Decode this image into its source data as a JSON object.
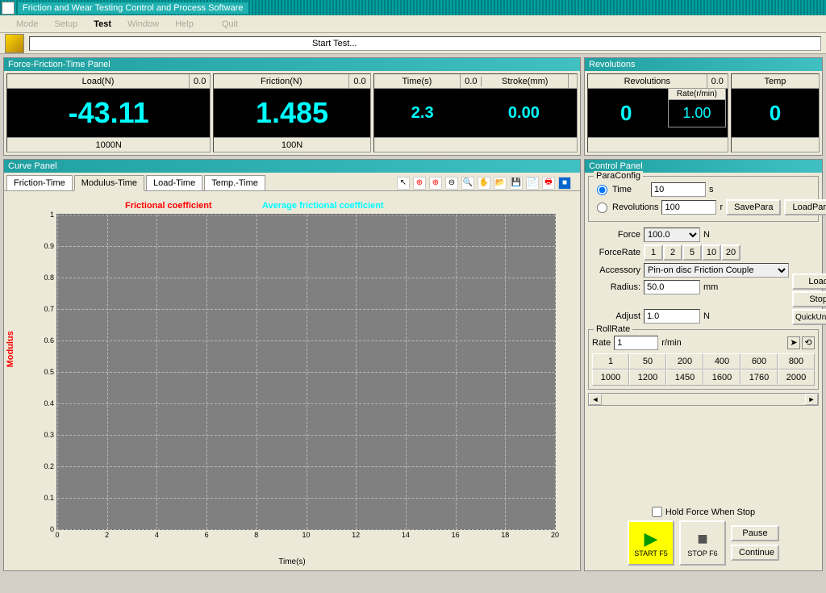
{
  "window": {
    "title": "Friction and Wear Testing Control and Process Software"
  },
  "menu": {
    "items": [
      "Mode",
      "Setup",
      "Test",
      "Window",
      "Help",
      "Quit"
    ],
    "active_index": 2
  },
  "start_bar": "Start Test...",
  "panels": {
    "force_friction": {
      "title": "Force-Friction-Time Panel",
      "load": {
        "label": "Load(N)",
        "small": "0.0",
        "value": "-43.11",
        "range": "1000N"
      },
      "friction": {
        "label": "Friction(N)",
        "small": "0.0",
        "value": "1.485",
        "range": "100N"
      },
      "time": {
        "label": "Time(s)",
        "small": "0.0",
        "value": "2.3"
      },
      "stroke": {
        "label": "Stroke(mm)",
        "small": "",
        "value": "0.00"
      }
    },
    "revolutions": {
      "title": "Revolutions",
      "rev": {
        "label": "Revolutions",
        "small": "0.0",
        "value": "0",
        "rate_label": "Rate(r/min)",
        "rate_value": "1.00"
      },
      "temp": {
        "label": "Temp",
        "value": "0"
      }
    }
  },
  "curve": {
    "title": "Curve Panel",
    "tabs": [
      "Friction-Time",
      "Modulus-Time",
      "Load-Time",
      "Temp.-Time"
    ],
    "active_tab": 1,
    "legend1": "Frictional coefficient",
    "legend2": "Average frictional coefficient",
    "ylabel": "Modulus",
    "xlabel": "Time(s)"
  },
  "control": {
    "title": "Control Panel",
    "para": {
      "legend": "ParaConfig",
      "time_label": "Time",
      "time_val": "10",
      "time_unit": "s",
      "rev_label": "Revolutions",
      "rev_val": "100",
      "rev_unit": "r",
      "save": "SavePara",
      "load": "LoadPara"
    },
    "force": {
      "label": "Force",
      "val": "100.0",
      "unit": "N"
    },
    "force_rate": {
      "label": "ForceRate",
      "buttons": [
        "1",
        "2",
        "5",
        "10",
        "20"
      ]
    },
    "accessory": {
      "label": "Accessory",
      "val": "Pin-on disc  Friction Couple"
    },
    "radius": {
      "label": "Radius:",
      "val": "50.0",
      "unit": "mm"
    },
    "adjust": {
      "label": "Adjust",
      "val": "1.0",
      "unit": "N"
    },
    "load_btn": "Load",
    "stop_btn": "Stop",
    "quick": "QuickUnload",
    "roll": {
      "legend": "RollRate",
      "rate_label": "Rate",
      "rate_val": "1",
      "rate_unit": "r/min",
      "presets": [
        "1",
        "50",
        "200",
        "400",
        "600",
        "800",
        "1000",
        "1200",
        "1450",
        "1600",
        "1760",
        "2000"
      ]
    },
    "hold_label": "Hold Force When Stop",
    "start_btn": "START F5",
    "big_stop": "STOP F6",
    "pause": "Pause",
    "cont": "Continue"
  },
  "chart_data": {
    "type": "line",
    "title": "",
    "xlabel": "Time(s)",
    "ylabel": "Modulus",
    "xlim": [
      0,
      20
    ],
    "ylim": [
      0,
      1
    ],
    "xticks": [
      0,
      2,
      4,
      6,
      8,
      10,
      12,
      14,
      16,
      18,
      20
    ],
    "yticks": [
      0,
      0.1,
      0.2,
      0.3,
      0.4,
      0.5,
      0.6,
      0.7,
      0.8,
      0.9,
      1
    ],
    "series": [
      {
        "name": "Frictional coefficient",
        "color": "red",
        "x": [],
        "y": []
      },
      {
        "name": "Average frictional coefficient",
        "color": "#00ffff",
        "x": [],
        "y": []
      }
    ]
  }
}
